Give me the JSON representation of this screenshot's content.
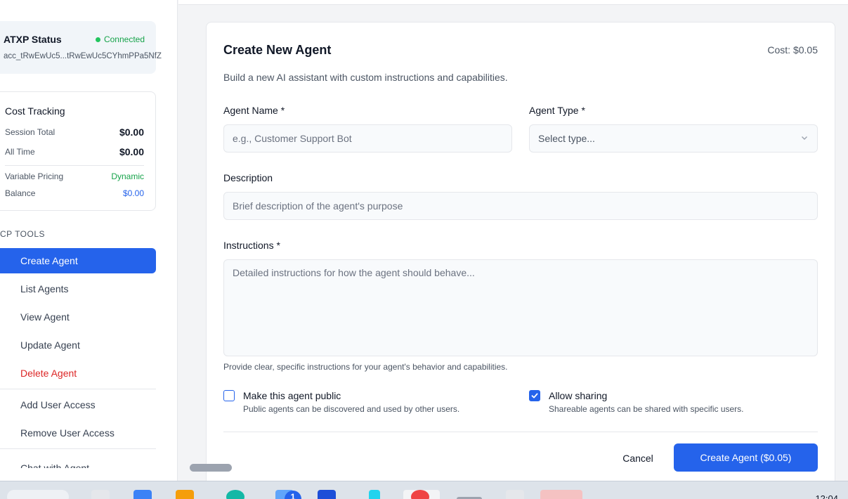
{
  "sidebar": {
    "atxp": {
      "title": "ATXP Status",
      "status": "Connected",
      "account": "acc_tRwEwUc5...tRwEwUc5CYhmPPa5NfZ"
    },
    "cost": {
      "title": "Cost Tracking",
      "session_label": "Session Total",
      "session_value": "$0.00",
      "alltime_label": "All Time",
      "alltime_value": "$0.00",
      "pricing_label": "Variable Pricing",
      "pricing_value": "Dynamic",
      "balance_label": "Balance",
      "balance_value": "$0.00"
    },
    "tools_heading": "CP TOOLS",
    "items": [
      {
        "label": "Create Agent"
      },
      {
        "label": "List Agents"
      },
      {
        "label": "View Agent"
      },
      {
        "label": "Update Agent"
      },
      {
        "label": "Delete Agent"
      },
      {
        "label": "Add User Access"
      },
      {
        "label": "Remove User Access"
      },
      {
        "label": "Chat with Agent"
      }
    ]
  },
  "form": {
    "title": "Create New Agent",
    "cost": "Cost: $0.05",
    "subtitle": "Build a new AI assistant with custom instructions and capabilities.",
    "name_label": "Agent Name *",
    "name_placeholder": "e.g., Customer Support Bot",
    "type_label": "Agent Type *",
    "type_placeholder": "Select type...",
    "desc_label": "Description",
    "desc_placeholder": "Brief description of the agent's purpose",
    "instr_label": "Instructions *",
    "instr_placeholder": "Detailed instructions for how the agent should behave...",
    "instr_hint": "Provide clear, specific instructions for your agent's behavior and capabilities.",
    "public_label": "Make this agent public",
    "public_hint": "Public agents can be discovered and used by other users.",
    "sharing_label": "Allow sharing",
    "sharing_hint": "Shareable agents can be shared with specific users.",
    "cancel_label": "Cancel",
    "create_label": "Create Agent ($0.05)"
  },
  "taskbar": {
    "badge": "1",
    "clock": "12:04"
  }
}
